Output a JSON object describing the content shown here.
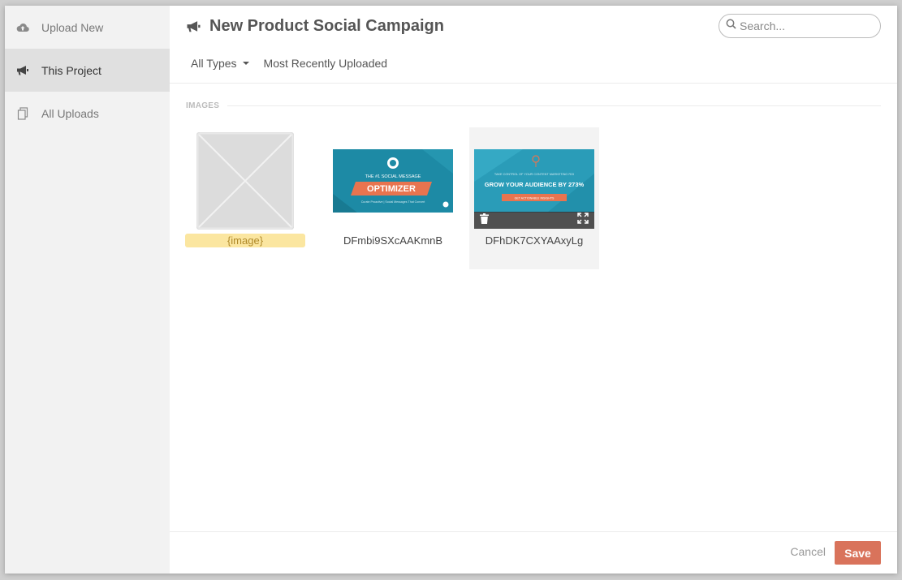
{
  "sidebar": {
    "items": [
      {
        "label": "Upload New",
        "icon": "cloud-upload-icon"
      },
      {
        "label": "This Project",
        "icon": "megaphone-icon",
        "active": true
      },
      {
        "label": "All Uploads",
        "icon": "copy-icon"
      }
    ]
  },
  "header": {
    "title": "New Product Social Campaign",
    "title_icon": "megaphone-icon",
    "search_placeholder": "Search...",
    "filters": {
      "type": "All Types",
      "sort": "Most Recently Uploaded"
    }
  },
  "section": {
    "label": "IMAGES"
  },
  "images": [
    {
      "name": "{image}",
      "kind": "placeholder",
      "highlighted": true
    },
    {
      "name": "DFmbi9SXcAAKmnB",
      "kind": "thumbnail",
      "thumb_lines": [
        "THE #1 SOCIAL MESSAGE",
        "OPTIMIZER",
        "Curate Proactive | Social Messages That Convert"
      ]
    },
    {
      "name": "DFhDK7CXYAAxyLg",
      "kind": "thumbnail",
      "hovered": true,
      "thumb_lines": [
        "TAKE CONTROL OF YOUR CONTENT MARKETING ROI",
        "GROW YOUR AUDIENCE BY 273%",
        "GET ACTIONABLE INSIGHTS"
      ]
    }
  ],
  "footer": {
    "cancel_label": "Cancel",
    "save_label": "Save"
  },
  "colors": {
    "accent": "#d9735b",
    "sidebar_bg": "#f2f2f2",
    "sidebar_active": "#e0e0e0",
    "highlight": "#fbe6a0",
    "thumb_teal": "#1d8aa5",
    "thumb_orange": "#e8744f"
  }
}
